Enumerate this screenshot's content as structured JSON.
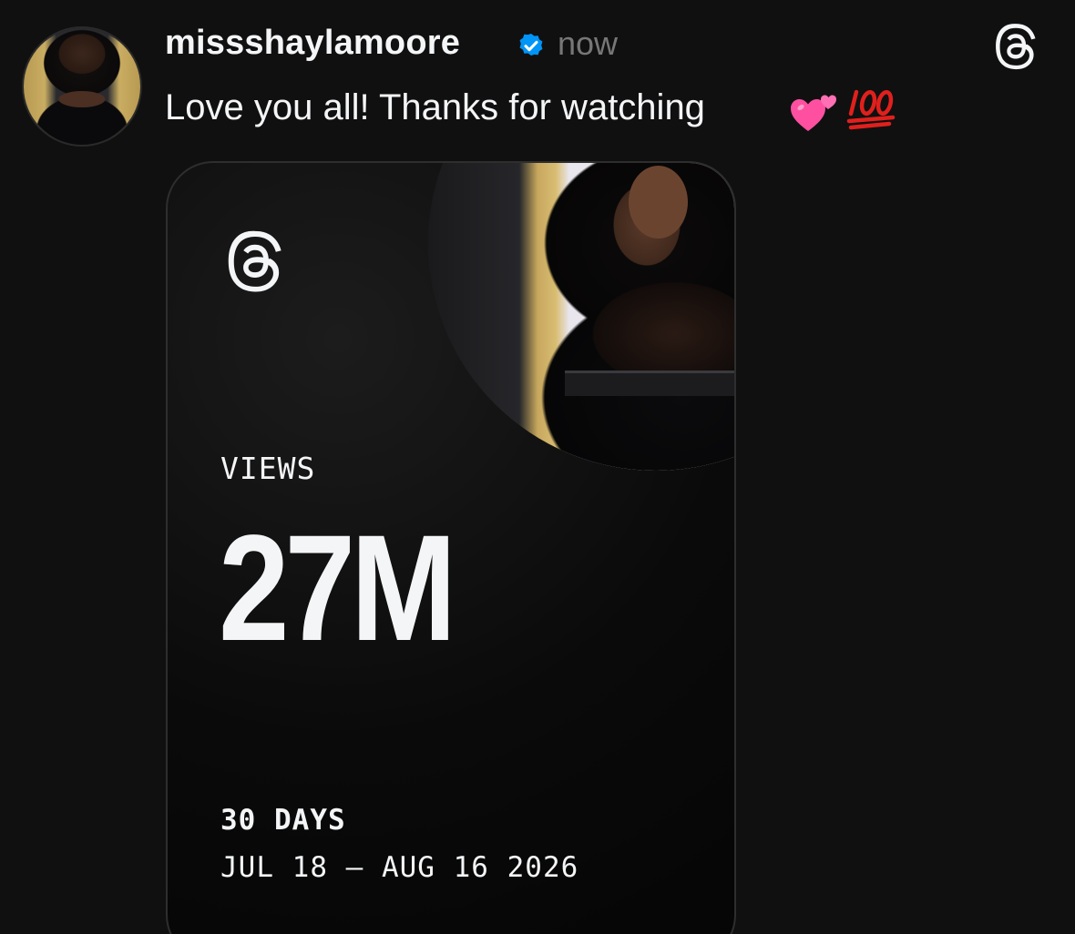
{
  "post": {
    "username": "missshaylamoore",
    "verified": true,
    "timestamp": "now",
    "caption": "Love you all! Thanks for watching",
    "caption_emojis": [
      "two-hearts-emoji",
      "hundred-points-emoji"
    ]
  },
  "insight_card": {
    "metric_label": "VIEWS",
    "metric_value": "27M",
    "period_label": "30 DAYS",
    "date_range": "JUL 18 — AUG 16 2026"
  },
  "icons": {
    "app_logo": "threads-logo-icon",
    "verified": "verified-badge-icon"
  },
  "colors": {
    "background": "#101010",
    "text_primary": "#f3f5f7",
    "text_secondary": "#777777",
    "verified_blue": "#0095f6",
    "card_background": "#0a0a0a",
    "card_border": "#2e2e2e",
    "heart_pink": "#ff4fa0",
    "hundred_red": "#e0201d"
  }
}
